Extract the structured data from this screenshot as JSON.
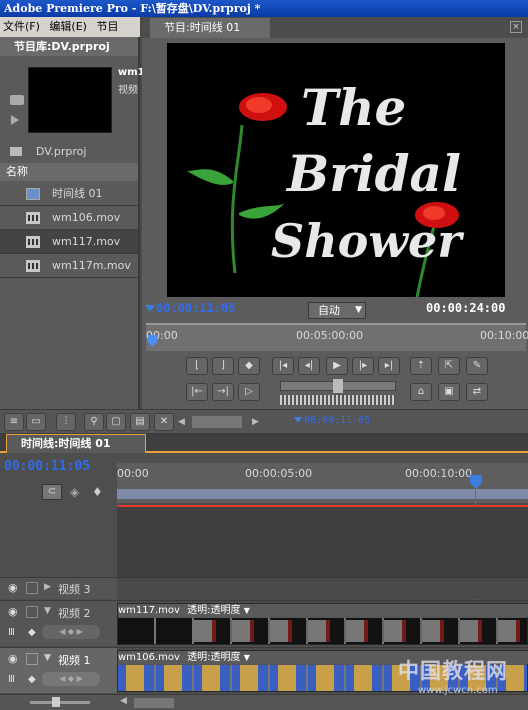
{
  "app": {
    "title": "Adobe Premiere Pro - F:\\暂存盘\\DV.prproj *"
  },
  "menu": {
    "file": "文件(F)",
    "edit": "编辑(E)",
    "project": "节目"
  },
  "project_panel": {
    "tab": "节目库:DV.prproj",
    "preview_name": "wm1",
    "preview_info": "视频",
    "project_file": "DV.prproj",
    "column_header": "名称",
    "items": [
      {
        "name": "时间线 01",
        "icon": "sequence-icon",
        "selected": false
      },
      {
        "name": "wm106.mov",
        "icon": "film-icon",
        "selected": false
      },
      {
        "name": "wm117.mov",
        "icon": "film-icon",
        "selected": true
      },
      {
        "name": "wm117m.mov",
        "icon": "film-icon",
        "selected": false
      }
    ]
  },
  "monitor": {
    "tab": "节目:时间线 01",
    "video_text": [
      "The",
      "Bridal",
      "Shower"
    ],
    "current_time": "00:00:11:05",
    "zoom": "自动",
    "duration": "00:00:24:00",
    "ruler": [
      "00:00",
      "00:05:00:00",
      "00:10:00"
    ]
  },
  "timeline": {
    "toolbar_time": "00:00:11:05",
    "tab": "时间线:时间线 01",
    "current_time": "00:00:11:05",
    "ruler": [
      "00:00",
      "00:00:05:00",
      "00:00:10:00"
    ],
    "tracks": [
      {
        "label": "视频 3"
      },
      {
        "label": "视频 2",
        "clip_name": "wm117.mov",
        "clip_fx": "透明:透明度"
      },
      {
        "label": "视频 1",
        "clip_name": "wm106.mov",
        "clip_fx": "透明:透明度"
      }
    ]
  },
  "watermark": {
    "text1": "中国教程网",
    "text2": "www.jcwcn.com"
  },
  "colors": {
    "accent_blue": "#2f6cf0",
    "playhead": "#e23b2b",
    "tab_orange": "#e8a23c",
    "titlebar": "#0a3aa8"
  }
}
